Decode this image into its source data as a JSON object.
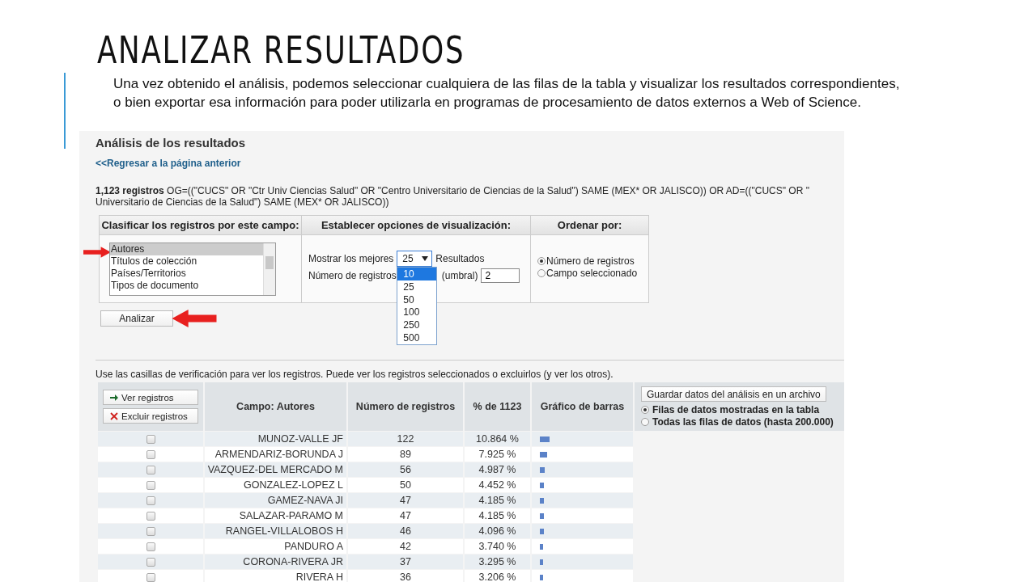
{
  "slide": {
    "title": "ANALIZAR RESULTADOS",
    "intro": "Una vez obtenido el análisis, podemos seleccionar cualquiera de las filas de la tabla y visualizar los resultados correspondientes, o bien exportar esa información para poder utilizarla en programas de procesamiento de datos externos a Web of Science."
  },
  "page": {
    "heading": "Análisis de los resultados",
    "back_link": "<<Regresar a la página anterior",
    "query_lines": [
      "**1,123 registros** OG=((\"CUCS\" OR \"Ctr Univ Ciencias Salud\" OR \"Centro Universitario de Ciencias de la Salud\") SAME (MEX* OR JALISCO)) OR AD=((\"CUCS\" OR \"",
      "Universitario de Ciencias de la Salud\") SAME (MEX* OR JALISCO))"
    ]
  },
  "options": {
    "columns": [
      "Clasificar los registros por este campo:",
      "Establecer opciones de visualización:",
      "Ordenar por:"
    ],
    "field_list": [
      {
        "label": "Autores",
        "selected": true
      },
      {
        "label": "Títulos de colección",
        "selected": false
      },
      {
        "label": "Países/Territorios",
        "selected": false
      },
      {
        "label": "Tipos de documento",
        "selected": false
      }
    ],
    "show_label": "Mostrar los mejores",
    "show_select": {
      "value": "25",
      "expanded": true,
      "options": [
        {
          "label": "10",
          "highlighted": true
        },
        {
          "label": "25",
          "highlighted": false
        },
        {
          "label": "50",
          "highlighted": false
        },
        {
          "label": "100",
          "highlighted": false
        },
        {
          "label": "250",
          "highlighted": false
        },
        {
          "label": "500",
          "highlighted": false
        }
      ]
    },
    "show_suffix": "Resultados",
    "threshold_label": "Número de registros",
    "threshold_suffix": "(umbral)",
    "threshold_value": "2",
    "sort": [
      {
        "label": "Número de registros",
        "selected": true
      },
      {
        "label": "Campo seleccionado",
        "selected": false
      }
    ],
    "analyze_button": "Analizar"
  },
  "results": {
    "note": "Use las casillas de verificación para ver los registros. Puede ver los registros seleccionados o excluirlos (y ver los otros).",
    "buttons": [
      {
        "kind": "view",
        "label": "Ver registros"
      },
      {
        "kind": "exclude",
        "label": "Excluir registros"
      }
    ],
    "columns": [
      "Campo: Autores",
      "Número de registros",
      "% de 1123",
      "Gráfico de barras"
    ],
    "save_button": "Guardar datos del análisis en un archivo",
    "save_scope": [
      {
        "label": "Filas de datos mostradas en la tabla",
        "selected": true
      },
      {
        "label": "Todas las filas de datos (hasta 200.000)",
        "selected": false
      }
    ],
    "rows": [
      {
        "checked": false,
        "name": "MUNOZ-VALLE JF",
        "count": "122",
        "percent": "10.864 %",
        "level": 0.109
      },
      {
        "checked": false,
        "name": "ARMENDARIZ-BORUNDA J",
        "count": "89",
        "percent": "7.925 %",
        "level": 0.079
      },
      {
        "checked": false,
        "name": "VAZQUEZ-DEL MERCADO M",
        "count": "56",
        "percent": "4.987 %",
        "level": 0.05
      },
      {
        "checked": false,
        "name": "GONZALEZ-LOPEZ L",
        "count": "50",
        "percent": "4.452 %",
        "level": 0.045
      },
      {
        "checked": false,
        "name": "GAMEZ-NAVA JI",
        "count": "47",
        "percent": "4.185 %",
        "level": 0.042
      },
      {
        "checked": false,
        "name": "SALAZAR-PARAMO M",
        "count": "47",
        "percent": "4.185 %",
        "level": 0.042
      },
      {
        "checked": false,
        "name": "RANGEL-VILLALOBOS H",
        "count": "46",
        "percent": "4.096 %",
        "level": 0.041
      },
      {
        "checked": false,
        "name": "PANDURO A",
        "count": "42",
        "percent": "3.740 %",
        "level": 0.037
      },
      {
        "checked": false,
        "name": "CORONA-RIVERA JR",
        "count": "37",
        "percent": "3.295 %",
        "level": 0.033
      },
      {
        "checked": false,
        "name": "RIVERA H",
        "count": "36",
        "percent": "3.206 %",
        "level": 0.032
      }
    ]
  }
}
